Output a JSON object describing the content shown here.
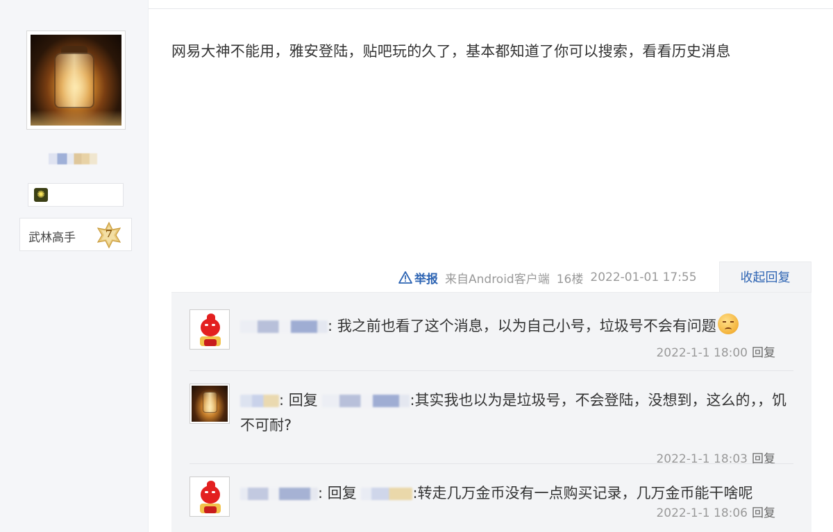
{
  "author": {
    "avatar_name": "lantern-avatar",
    "level_title": "武林高手",
    "level_number": "7",
    "badge_icon": "sun-badge-icon"
  },
  "post": {
    "content": "网易大神不能用，雅安登陆，贴吧玩的久了，基本都知道了你可以搜索，看看历史消息",
    "report_label": "举报",
    "source": "来自Android客户端",
    "floor": "16楼",
    "timestamp": "2022-01-01 17:55",
    "collapse_label": "收起回复"
  },
  "replies": [
    {
      "separator": ":",
      "text": " 我之前也看了这个消息，以为自己小号，垃圾号不会有问题",
      "time": "2022-1-1 18:00",
      "reply_label": "回复"
    },
    {
      "reply_to_prefix": ": 回复",
      "separator": ":",
      "text": "其实我也以为是垃圾号，不会登陆，没想到，这么的，，饥不可耐?",
      "time": "2022-1-1 18:03",
      "reply_label": "回复"
    },
    {
      "reply_to_prefix": ": 回复",
      "separator": ":",
      "text": "转走几万金币没有一点购买记录，几万金币能干啥呢",
      "time": "2022-1-1 18:06",
      "reply_label": "回复"
    }
  ],
  "colors": {
    "link_blue": "#2d64b3",
    "meta_gray": "#999999",
    "panel_bg": "#f3f4f6",
    "sidebar_bg": "#f5f6f9"
  }
}
